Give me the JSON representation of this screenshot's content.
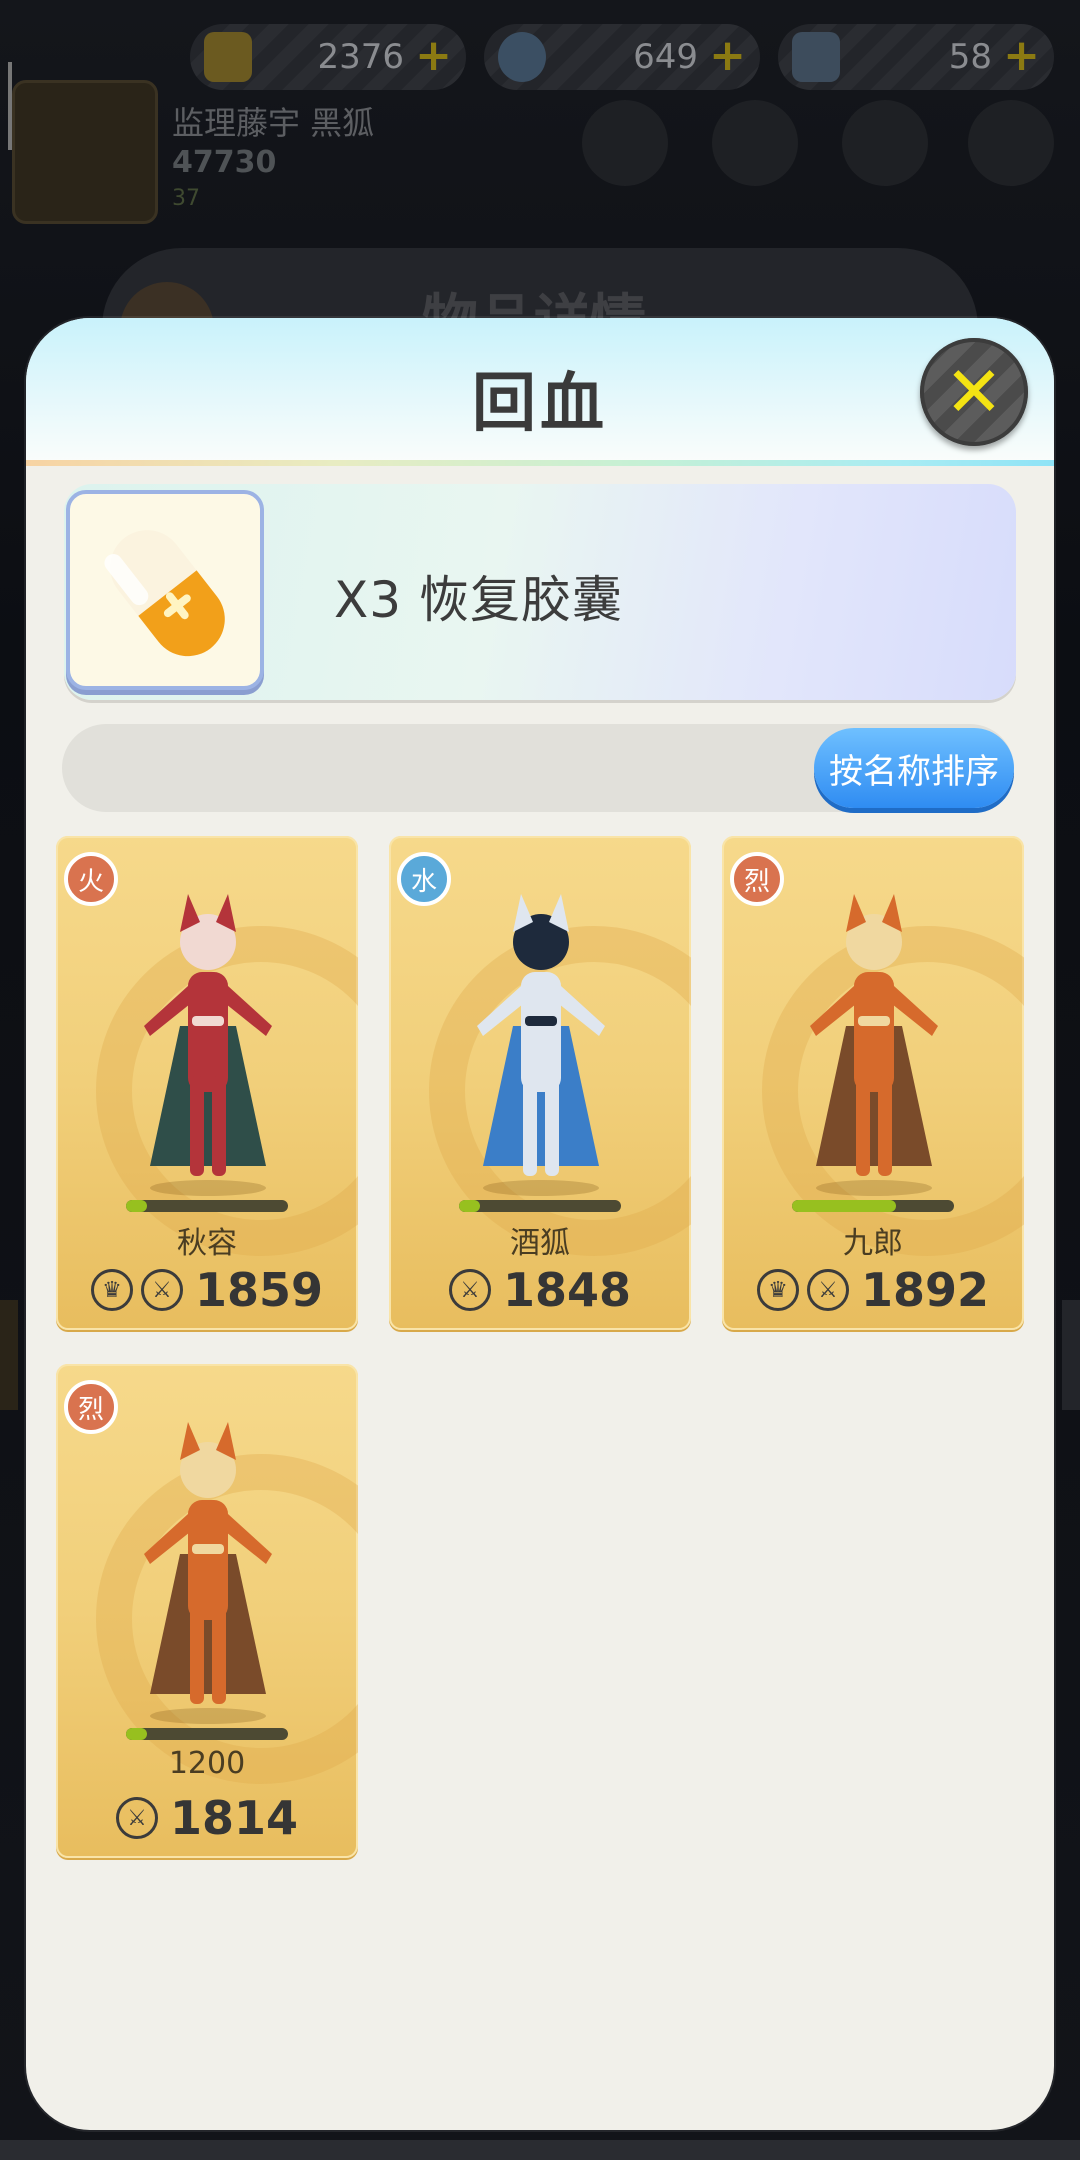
{
  "hud": {
    "currencies": [
      {
        "icon": "gold-ingot-icon",
        "value": "2376",
        "color": "#6b5a20"
      },
      {
        "icon": "diamond-icon",
        "value": "649",
        "color": "#3b4f63"
      },
      {
        "icon": "ticket-icon",
        "value": "58",
        "color": "#3d4c5c"
      }
    ],
    "player": {
      "name": "监理藤宇 黑狐",
      "power": "47730",
      "level": "37"
    },
    "background_panel_title": "物品详情"
  },
  "modal": {
    "title": "回血",
    "close_icon": "close-icon"
  },
  "item": {
    "icon": "capsule-icon",
    "label": "X3  恢复胶囊"
  },
  "sort": {
    "label": "按名称排序"
  },
  "heroes": [
    {
      "name": "秋容",
      "element": "火",
      "element_color": "#d9734f",
      "power": "1859",
      "hp_fraction": 0.13,
      "has_crown": true,
      "palette": [
        "#b4343a",
        "#2f4e49",
        "#f1d9d2"
      ]
    },
    {
      "name": "酒狐",
      "element": "水",
      "element_color": "#5aa9d9",
      "power": "1848",
      "hp_fraction": 0.13,
      "has_crown": false,
      "palette": [
        "#dfe6ef",
        "#3b7ec8",
        "#1e2a3c"
      ]
    },
    {
      "name": "九郎",
      "element": "烈",
      "element_color": "#d9734f",
      "power": "1892",
      "hp_fraction": 0.64,
      "has_crown": true,
      "palette": [
        "#d66a2c",
        "#7a4b2a",
        "#f0d8a0"
      ]
    },
    {
      "name": "1200",
      "element": "烈",
      "element_color": "#d9734f",
      "power": "1814",
      "hp_fraction": 0.13,
      "has_crown": false,
      "palette": [
        "#d66a2c",
        "#7a4b2a",
        "#f0d8a0"
      ]
    }
  ]
}
